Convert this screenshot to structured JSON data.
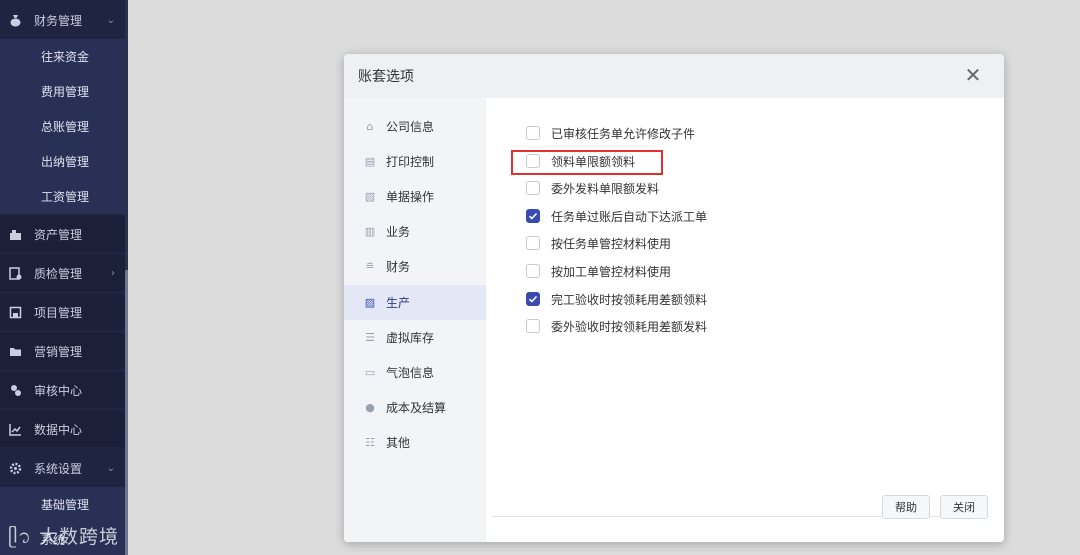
{
  "sidebar": {
    "groups": [
      {
        "label": "财务管理",
        "icon": "money-bag-icon",
        "caret": "⌄"
      },
      {
        "label": "资产管理",
        "icon": "asset-icon"
      },
      {
        "label": "质检管理",
        "icon": "quality-icon",
        "caret": "›"
      },
      {
        "label": "项目管理",
        "icon": "project-icon"
      },
      {
        "label": "营销管理",
        "icon": "folder-icon"
      },
      {
        "label": "审核中心",
        "icon": "review-icon"
      },
      {
        "label": "数据中心",
        "icon": "data-chart-icon"
      },
      {
        "label": "系统设置",
        "icon": "settings-icon",
        "caret": "⌄"
      }
    ],
    "finance_subitems": [
      "往来资金",
      "费用管理",
      "总账管理",
      "出纳管理",
      "工资管理"
    ],
    "settings_subitems": [
      "基础管理",
      "系统"
    ]
  },
  "watermark": "大数跨境",
  "dialog": {
    "title": "账套选项",
    "close_symbol": "✕",
    "menu": [
      {
        "label": "公司信息",
        "icon": "bank-icon"
      },
      {
        "label": "打印控制",
        "icon": "printer-icon"
      },
      {
        "label": "单据操作",
        "icon": "document-edit-icon"
      },
      {
        "label": "业务",
        "icon": "briefcase-icon"
      },
      {
        "label": "财务",
        "icon": "database-icon"
      },
      {
        "label": "生产",
        "icon": "production-icon",
        "active": true
      },
      {
        "label": "虚拟库存",
        "icon": "inventory-icon"
      },
      {
        "label": "气泡信息",
        "icon": "message-bubble-icon"
      },
      {
        "label": "成本及结算",
        "icon": "coin-bag-icon"
      },
      {
        "label": "其他",
        "icon": "list-icon"
      }
    ],
    "options": [
      {
        "label": "已审核任务单允许修改子件",
        "checked": false
      },
      {
        "label": "领料单限额领料",
        "checked": false
      },
      {
        "label": "委外发料单限额发料",
        "checked": false
      },
      {
        "label": "任务单过账后自动下达派工单",
        "checked": true
      },
      {
        "label": "按任务单管控材料使用",
        "checked": false
      },
      {
        "label": "按加工单管控材料使用",
        "checked": false
      },
      {
        "label": "完工验收时按领耗用差额领料",
        "checked": true
      },
      {
        "label": "委外验收时按领耗用差额发料",
        "checked": false
      }
    ],
    "buttons": {
      "help": "帮助",
      "close": "关闭"
    }
  },
  "colors": {
    "sidebar_bg": "#1f2440",
    "accent": "#3a4bb0",
    "highlight": "#e0322b"
  }
}
